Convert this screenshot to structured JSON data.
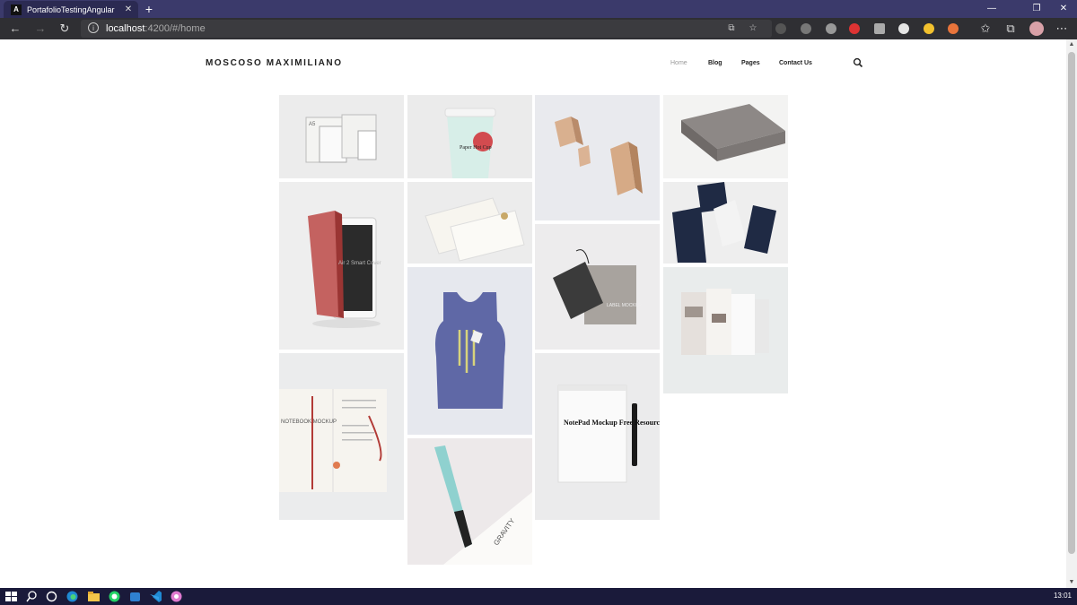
{
  "browser": {
    "tab_title": "PortafolioTestingAngular",
    "tab_favicon": "A",
    "url_host": "localhost",
    "url_rest": ":4200/#/home"
  },
  "site": {
    "logo": "MOSCOSO MAXIMILIANO",
    "nav": [
      "Home",
      "Blog",
      "Pages",
      "Contact Us"
    ],
    "active_nav": "Home"
  },
  "portfolio": {
    "tiles": [
      {
        "name": "stationery-mockup",
        "label": "A5"
      },
      {
        "name": "paper-hot-cup-mockup",
        "label": "Paper Hot Cup"
      },
      {
        "name": "wooden-blocks-mockup",
        "label": ""
      },
      {
        "name": "gray-box-mockup",
        "label": ""
      },
      {
        "name": "ipad-air-smart-cover-mockup",
        "label": "Air 2 Smart Cover"
      },
      {
        "name": "business-card-mockup",
        "label": ""
      },
      {
        "name": "dark-cards-mockup",
        "label": ""
      },
      {
        "name": "label-tag-mockup",
        "label": "LABEL MOCKUP"
      },
      {
        "name": "tank-top-mockup",
        "label": ""
      },
      {
        "name": "app-screens-mockup",
        "label": ""
      },
      {
        "name": "notebook-mockup",
        "label": "NOTEBOOK MOCKUP"
      },
      {
        "name": "notepad-mockup",
        "label": "NotePad Mockup Free Resource"
      },
      {
        "name": "pen-gravity-mockup",
        "label": "GRAVITY"
      }
    ]
  },
  "taskbar": {
    "clock": "13:01"
  },
  "colors": {
    "tabbar": "#3b3a6b",
    "taskbar": "#1a1a3a",
    "accent_red": "#c0504d"
  }
}
